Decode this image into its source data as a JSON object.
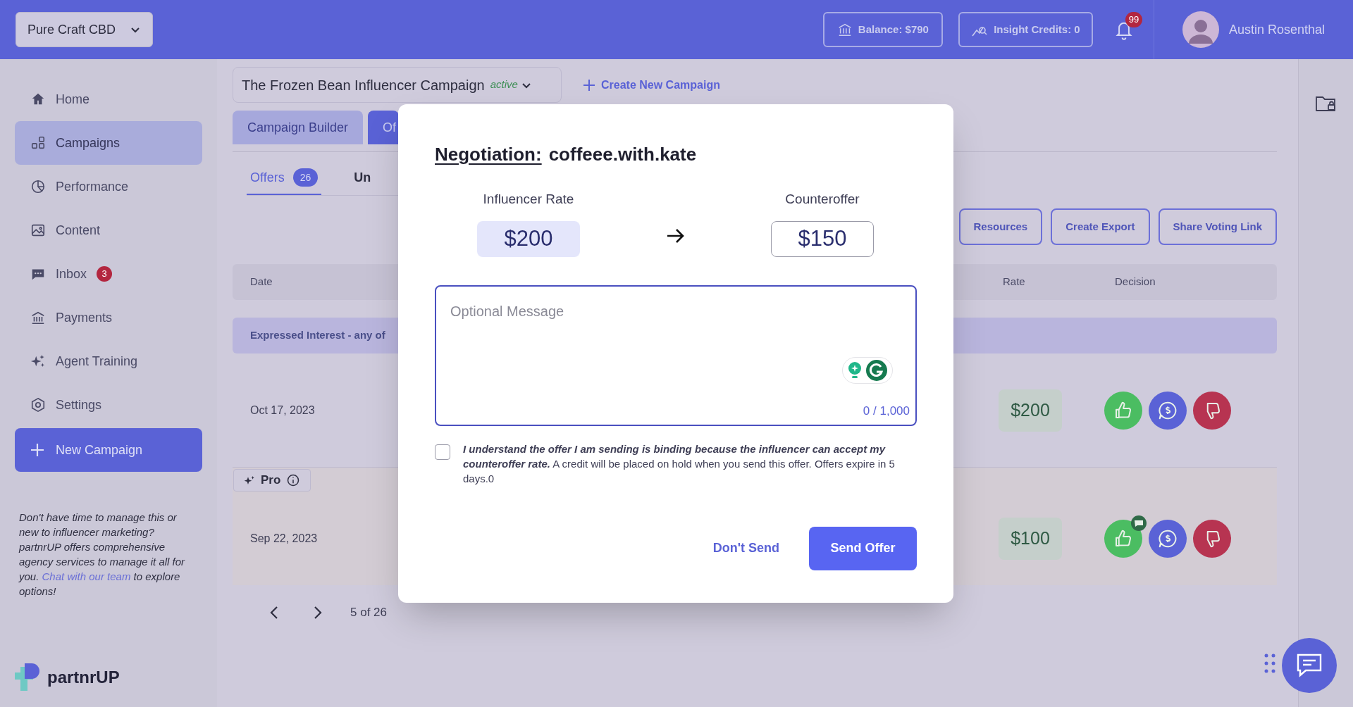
{
  "org_selector": {
    "label": "Pure Craft CBD"
  },
  "header": {
    "balance": "Balance: $790",
    "insight_credits": "Insight Credits: 0",
    "notification_count": "99",
    "user_name": "Austin Rosenthal"
  },
  "sidebar": {
    "items": [
      {
        "label": "Home",
        "selected": false
      },
      {
        "label": "Campaigns",
        "selected": true
      },
      {
        "label": "Performance",
        "selected": false
      },
      {
        "label": "Content",
        "selected": false
      },
      {
        "label": "Inbox",
        "selected": false,
        "badge": "3"
      },
      {
        "label": "Payments",
        "selected": false
      },
      {
        "label": "Agent Training",
        "selected": false
      },
      {
        "label": "Settings",
        "selected": false
      }
    ],
    "new_campaign": "New Campaign",
    "promo": {
      "text": "Don't have time to manage this or new to influencer marketing? partnrUP offers comprehensive agency services to manage it all for you.",
      "link": "Chat with our team",
      "text_after": "to explore options!"
    },
    "logo": "partnrUP"
  },
  "campaign": {
    "name": "The Frozen Bean Influencer Campaign",
    "status": "active"
  },
  "create_campaign": "Create New Campaign",
  "tabs": [
    {
      "label": "Campaign Builder",
      "selected": false
    },
    {
      "label": "Of",
      "selected": true
    }
  ],
  "subtabs": [
    {
      "label": "Offers",
      "count": "26",
      "selected": true
    },
    {
      "label": "Un",
      "selected": false
    }
  ],
  "actions": [
    "Resources",
    "Create Export",
    "Share Voting Link"
  ],
  "table": {
    "columns": [
      "Date",
      "Rate",
      "Decision"
    ],
    "group_row": "Expressed Interest - any of",
    "rows": [
      {
        "date": "Oct 17, 2023",
        "rate": "$200",
        "highlighted": false,
        "has_message": false
      },
      {
        "pro_badge": "Pro",
        "date": "Sep 22, 2023",
        "rate": "$100",
        "highlighted": true,
        "has_message": true
      }
    ]
  },
  "pagination": {
    "label": "5 of 26"
  },
  "modal": {
    "title_label": "Negotiation:",
    "influencer": "coffeee.with.kate",
    "influencer_rate_label": "Influencer Rate",
    "influencer_rate": "$200",
    "counteroffer_label": "Counteroffer",
    "counteroffer": "$150",
    "message_placeholder": "Optional Message",
    "char_count": "0 / 1,000",
    "agree_checked": false,
    "agree_emphasis": "I understand the offer I am sending is binding because the influencer can accept my counteroffer rate.",
    "agree_text": "A credit will be placed on hold when you send this offer. Offers expire in 5 days.0",
    "cancel_button": "Don't Send",
    "send_button": "Send Offer"
  }
}
